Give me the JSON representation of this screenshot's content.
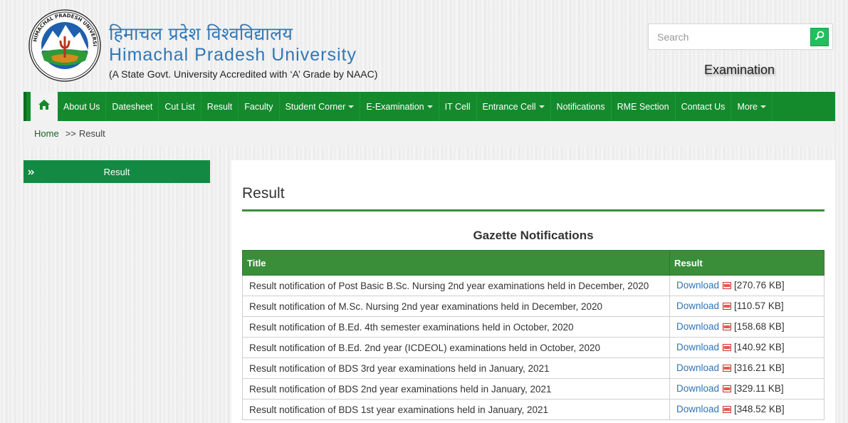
{
  "header": {
    "title_hindi": "हिमाचल प्रदेश विश्वविद्यालय",
    "title_english": "Himachal Pradesh University",
    "tagline": "(A State Govt. University Accredited with ‘A’ Grade by NAAC)",
    "logo_text": "HIMACHAL PRADESH UNIVERSITY",
    "section_label": "Examination"
  },
  "search": {
    "placeholder": "Search",
    "icon": "search-icon"
  },
  "nav": {
    "home_icon": "home-icon",
    "items": [
      {
        "label": "About Us",
        "dropdown": false
      },
      {
        "label": "Datesheet",
        "dropdown": false
      },
      {
        "label": "Cut List",
        "dropdown": false
      },
      {
        "label": "Result",
        "dropdown": false
      },
      {
        "label": "Faculty",
        "dropdown": false
      },
      {
        "label": "Student Corner",
        "dropdown": true
      },
      {
        "label": "E-Examination",
        "dropdown": true
      },
      {
        "label": "IT Cell",
        "dropdown": false
      },
      {
        "label": "Entrance Cell",
        "dropdown": true
      },
      {
        "label": "Notifications",
        "dropdown": false
      },
      {
        "label": "RME Section",
        "dropdown": false
      },
      {
        "label": "Contact Us",
        "dropdown": false
      },
      {
        "label": "More",
        "dropdown": true
      }
    ]
  },
  "breadcrumb": {
    "home": "Home",
    "separator": ">>",
    "current": "Result"
  },
  "sidebar": {
    "items": [
      {
        "label": "Result"
      }
    ]
  },
  "main": {
    "title": "Result",
    "section_title": "Gazette Notifications",
    "table": {
      "headers": [
        "Title",
        "Result"
      ],
      "rows": [
        {
          "title": "Result notification of Post Basic B.Sc. Nursing 2nd year examinations held in December, 2020",
          "link": "Download",
          "size": "[270.76 KB]"
        },
        {
          "title": "Result notification of M.Sc. Nursing 2nd year examinations held in December, 2020",
          "link": "Download",
          "size": "[110.57 KB]"
        },
        {
          "title": "Result notification of B.Ed. 4th semester examinations held in October, 2020",
          "link": "Download",
          "size": "[158.68 KB]"
        },
        {
          "title": "Result notification of B.Ed. 2nd year (ICDEOL) examinations held in October, 2020",
          "link": "Download",
          "size": "[140.92 KB]"
        },
        {
          "title": "Result notification of BDS 3rd year examinations held in January, 2021",
          "link": "Download",
          "size": "[316.21 KB]"
        },
        {
          "title": "Result notification of BDS 2nd year examinations held in January, 2021",
          "link": "Download",
          "size": "[329.11 KB]"
        },
        {
          "title": "Result notification of BDS 1st year examinations held in January, 2021",
          "link": "Download",
          "size": "[348.52 KB]"
        }
      ]
    }
  },
  "colors": {
    "nav_green": "#148a2c",
    "sidebar_green": "#128a44",
    "table_header_green": "#3a8e3a",
    "link_blue": "#3173b5",
    "title_blue": "#2f78b9"
  }
}
